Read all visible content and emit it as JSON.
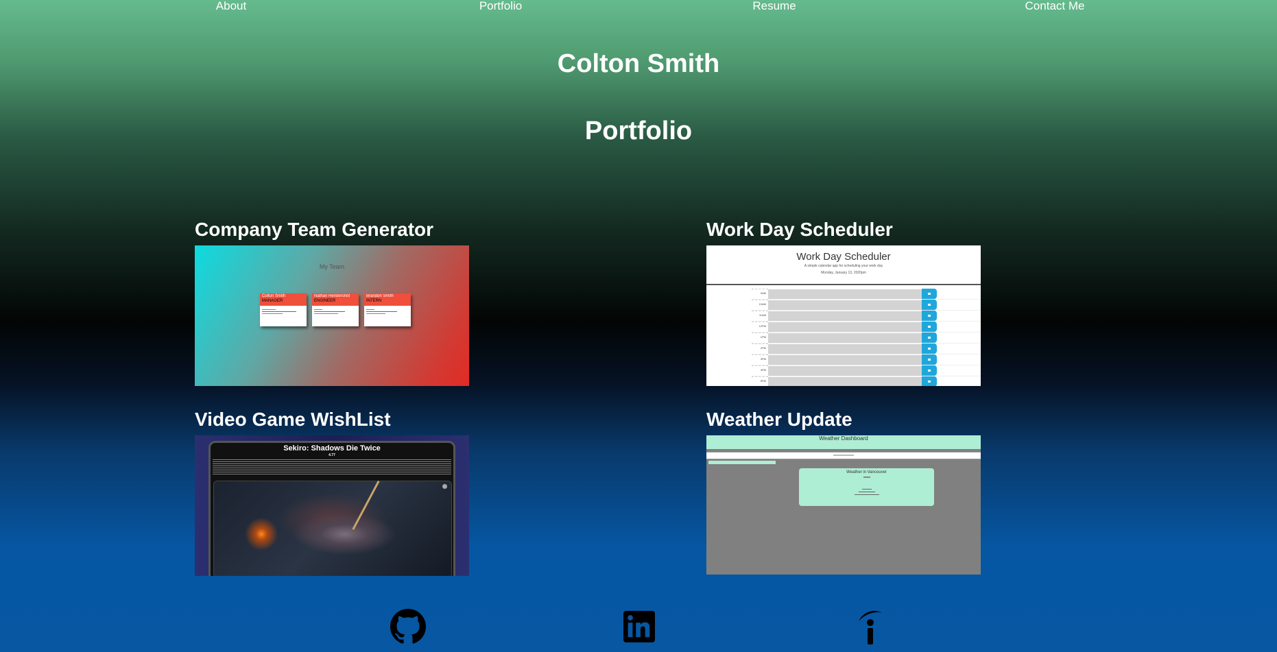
{
  "nav": {
    "about": "About",
    "portfolio": "Portfolio",
    "resume": "Resume",
    "contact": "Contact Me"
  },
  "header": {
    "name": "Colton Smith",
    "section": "Portfolio"
  },
  "projects": [
    {
      "title": "Company Team Generator",
      "preview": {
        "heading": "My Team",
        "cards": [
          {
            "name": "Colton Smith",
            "role": "MANAGER"
          },
          {
            "name": "Nathan Hendershot",
            "role": "ENGINEER"
          },
          {
            "name": "Brandon Smith",
            "role": "INTERN"
          }
        ]
      }
    },
    {
      "title": "Work Day Scheduler",
      "preview": {
        "heading": "Work Day Scheduler",
        "subheading": "A simple calendar app for scheduling your work day",
        "date": "Monday, January 13, 2020pm",
        "hours": [
          "9AM",
          "10AM",
          "11AM",
          "12PM",
          "1PM",
          "2PM",
          "3PM",
          "4PM",
          "5PM"
        ]
      }
    },
    {
      "title": "Video Game WishList",
      "preview": {
        "heading": "Sekiro: Shadows Die Twice",
        "rating": "4.77"
      }
    },
    {
      "title": "Weather Update",
      "preview": {
        "heading": "Weather Dashboard",
        "card_title": "Weather in Vancouver"
      }
    }
  ],
  "footer": {
    "icons": [
      "github-icon",
      "linkedin-icon",
      "indeed-icon"
    ]
  },
  "colors": {
    "accent_green": "#65bb8d",
    "deep_blue": "#0757a3",
    "scheduler_blue": "#1fa7dc",
    "weather_mint": "#aeeed4"
  }
}
